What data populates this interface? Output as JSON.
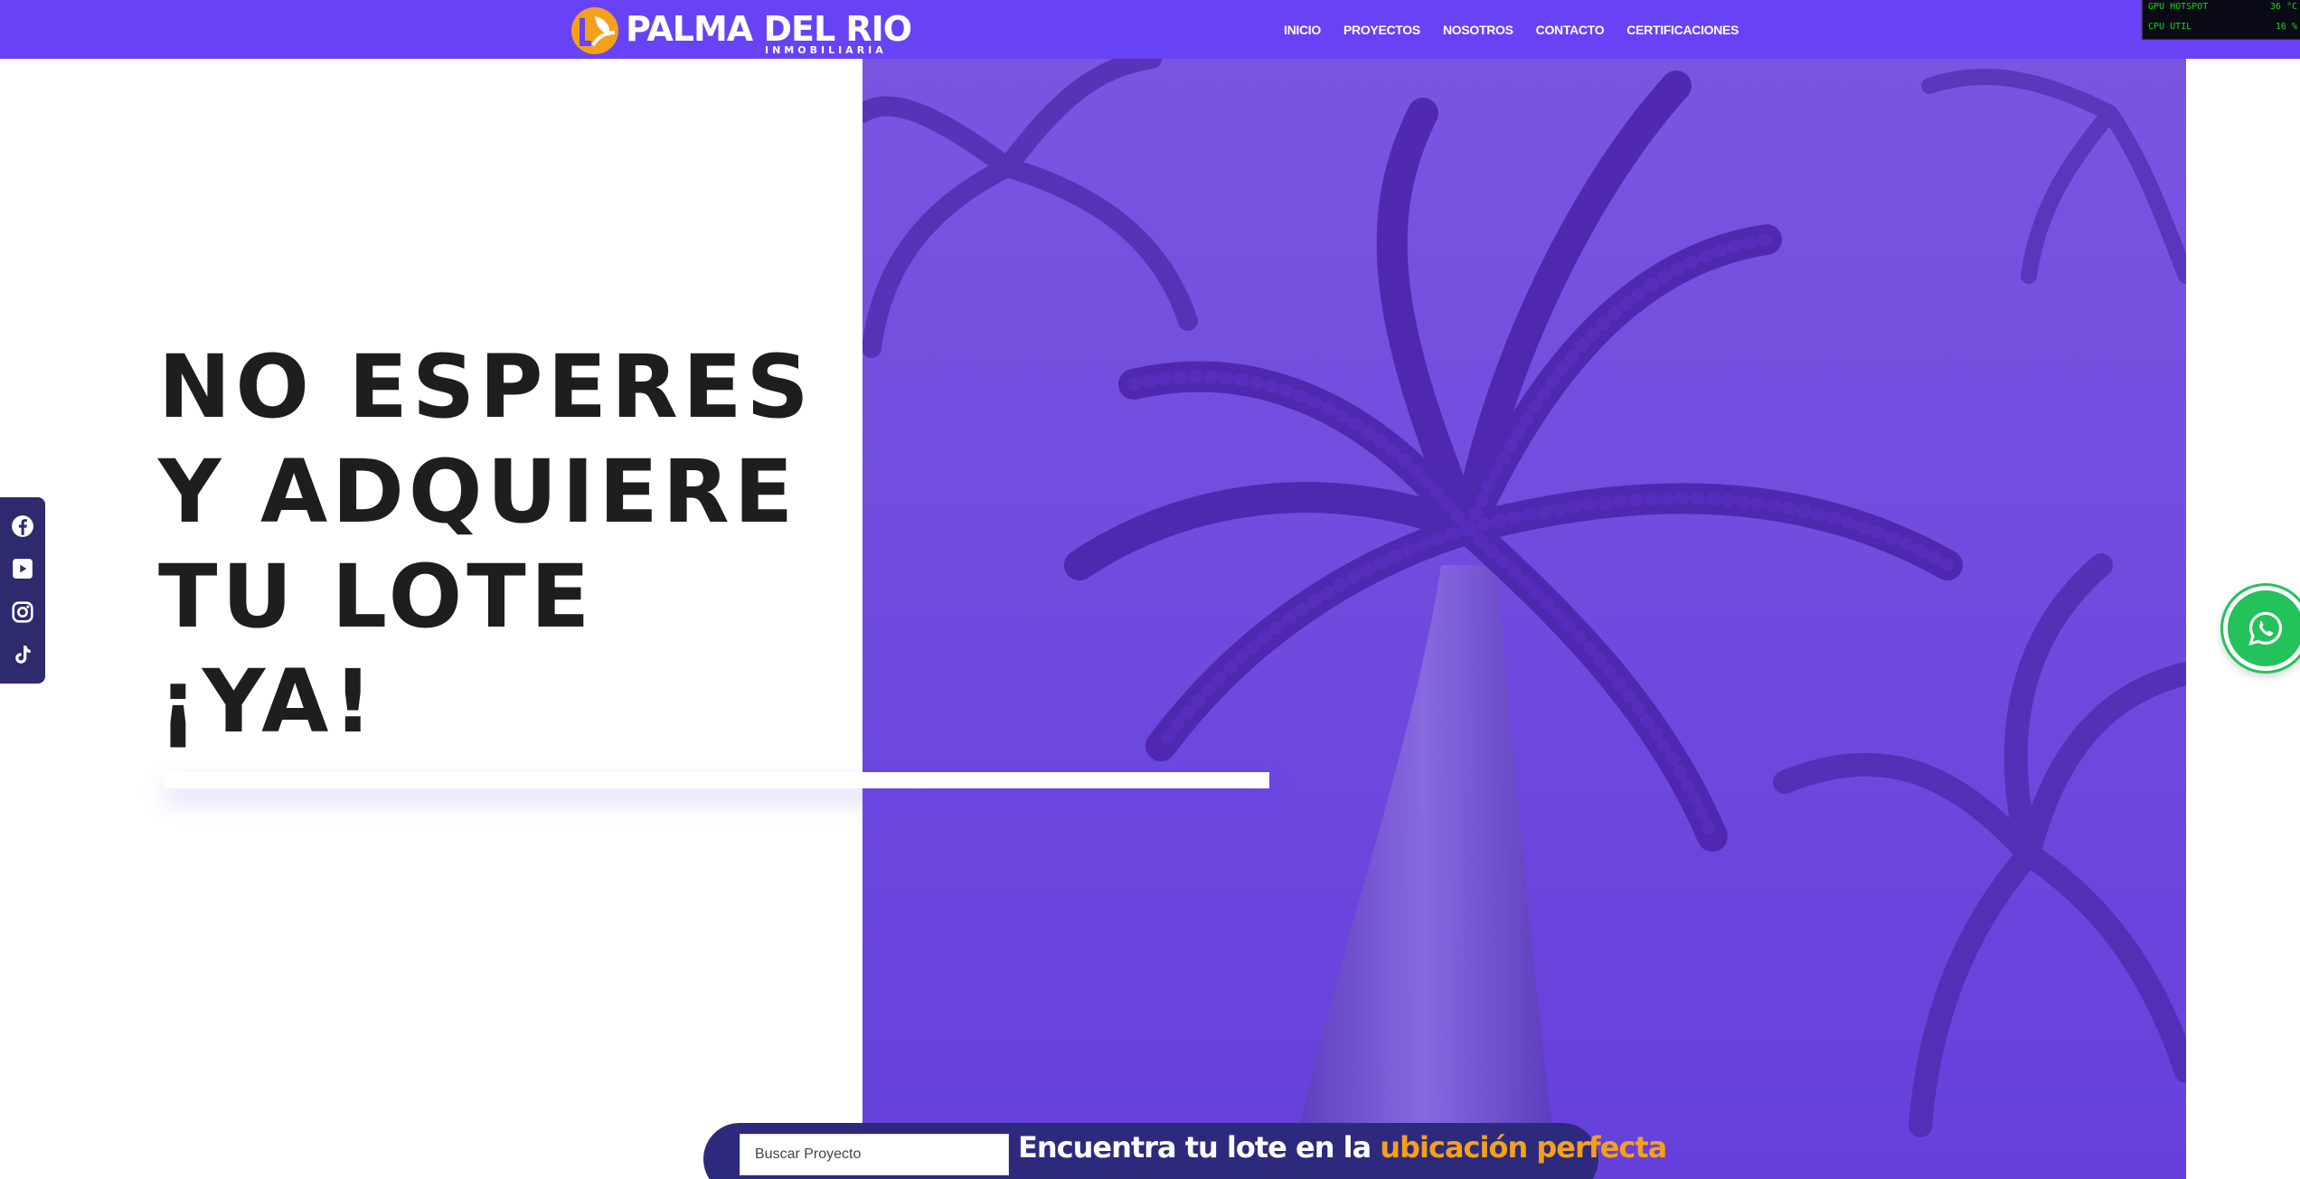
{
  "header": {
    "logo_name": "PALMA DEL RIO",
    "logo_subtitle": "INMOBILIARIA",
    "nav": [
      {
        "label": "INICIO"
      },
      {
        "label": "PROYECTOS"
      },
      {
        "label": "NOSOTROS"
      },
      {
        "label": "CONTACTO"
      },
      {
        "label": "CERTIFICACIONES"
      }
    ]
  },
  "hw_monitor": {
    "rows": [
      {
        "label": "GPU HOTSPOT",
        "value": "36 °C"
      },
      {
        "label": "CPU UTIL",
        "value": "16 %"
      }
    ]
  },
  "hero": {
    "headline_lines": [
      "NO ESPERES",
      "Y ADQUIERE",
      "TU LOTE",
      "¡YA!"
    ],
    "image_icon": "palm-trees-photo"
  },
  "social": {
    "icons": [
      "facebook-icon",
      "youtube-icon",
      "instagram-icon",
      "tiktok-icon"
    ]
  },
  "whatsapp": {
    "icon": "whatsapp-icon"
  },
  "search": {
    "placeholder": "Buscar Proyecto",
    "tagline_prefix": "Encuentra tu lote en la",
    "tagline_highlight": "ubicación perfecta"
  },
  "colors": {
    "brand_purple": "#6842f5",
    "brand_orange": "#f5a01a",
    "dark_navy": "#2d2a7e",
    "whatsapp_green": "#23c25a"
  }
}
